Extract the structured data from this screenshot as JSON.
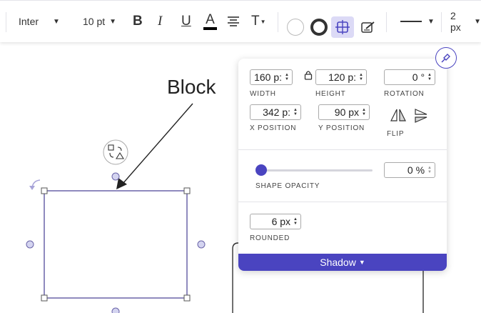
{
  "toolbar": {
    "font_family": "Inter",
    "font_size": "10 pt",
    "bold_glyph": "B",
    "italic_glyph": "I",
    "underline_glyph": "U",
    "font_color_glyph": "A",
    "text_style_glyph": "T",
    "line_width": "2 px",
    "icons": [
      "bold-icon",
      "italic-icon",
      "underline-icon",
      "font-color-icon",
      "align-icon",
      "text-style-icon",
      "fill-circle-icon",
      "stroke-circle-icon",
      "shape-options-icon",
      "style-icon",
      "line-style-icon"
    ]
  },
  "canvas": {
    "block_label": "Block",
    "colors": {
      "accent": "#4a44c0",
      "shape_stroke": "#6a64a8",
      "handle_fill": "#d4d4f0"
    }
  },
  "panel": {
    "width_value": "160 p:",
    "height_value": "120 p:",
    "rotation_value": "0 °",
    "width_label": "WIDTH",
    "height_label": "HEIGHT",
    "rotation_label": "ROTATION",
    "x_value": "342 p:",
    "y_value": "90 px",
    "x_label": "X POSITION",
    "y_label": "Y POSITION",
    "flip_label": "FLIP",
    "opacity_value": "0 %",
    "opacity_level": 0,
    "opacity_label": "SHAPE OPACITY",
    "rounded_value": "6 px",
    "rounded_label": "ROUNDED",
    "shadow_label": "Shadow"
  }
}
